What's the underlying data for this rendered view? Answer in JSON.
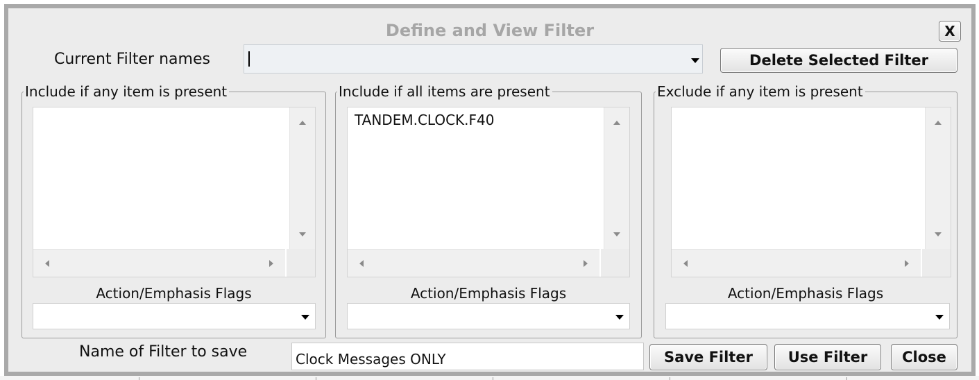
{
  "dialog": {
    "title": "Define and View Filter",
    "close_x_label": "X"
  },
  "current_filter": {
    "label": "Current Filter names",
    "value": "",
    "delete_button_label": "Delete Selected Filter"
  },
  "groups": [
    {
      "title": "Include if any item is present",
      "items": [],
      "flags_label": "Action/Emphasis Flags",
      "flags_value": ""
    },
    {
      "title": "Include if all items are present",
      "items": [
        "TANDEM.CLOCK.F40"
      ],
      "flags_label": "Action/Emphasis Flags",
      "flags_value": ""
    },
    {
      "title": "Exclude if any item is present",
      "items": [],
      "flags_label": "Action/Emphasis Flags",
      "flags_value": ""
    }
  ],
  "save": {
    "label": "Name of Filter to save",
    "name_value": "Clock Messages ONLY",
    "save_button_label": "Save Filter",
    "use_button_label": "Use Filter",
    "close_button_label": "Close"
  },
  "colors": {
    "dialog_background": "#ececec",
    "dialog_border": "#a9a9a9",
    "title_text": "#a6a6a6",
    "combo_background": "#eef1f4"
  },
  "icons": [
    "close-icon",
    "dropdown-arrow-icon",
    "scroll-up-arrow-icon",
    "scroll-down-arrow-icon",
    "scroll-left-arrow-icon",
    "scroll-right-arrow-icon"
  ]
}
